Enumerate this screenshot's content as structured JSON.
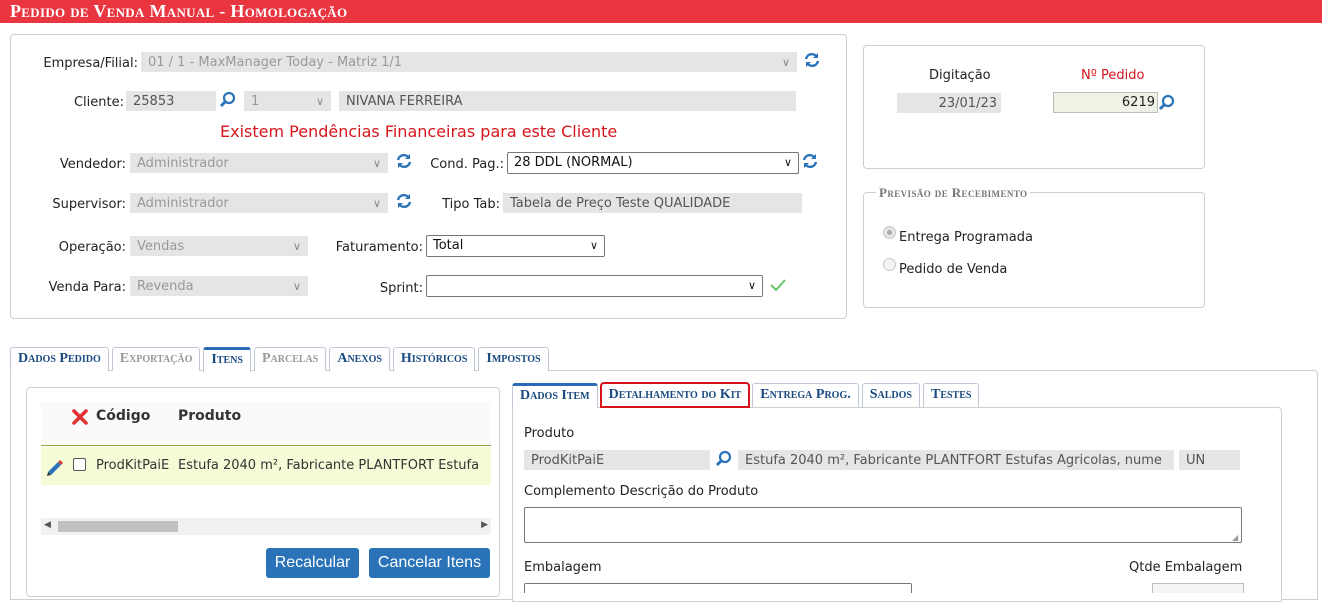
{
  "title": "Pedido de Venda Manual   - Homologação",
  "header": {
    "empresa_label": "Empresa/Filial:",
    "empresa_value": "01 / 1 - MaxManager Today - Matriz 1/1",
    "cliente_label": "Cliente:",
    "cliente_code": "25853",
    "cliente_seq": "1",
    "cliente_name": "NIVANA FERREIRA",
    "pendencias": "Existem Pendências Financeiras para este Cliente",
    "vendedor_label": "Vendedor:",
    "vendedor_value": "Administrador",
    "cond_pag_label": "Cond. Pag.:",
    "cond_pag_value": "28 DDL (NORMAL)",
    "supervisor_label": "Supervisor:",
    "supervisor_value": "Administrador",
    "tipo_tab_label": "Tipo Tab:",
    "tipo_tab_value": "Tabela de Preço Teste QUALIDADE",
    "operacao_label": "Operação:",
    "operacao_value": "Vendas",
    "faturamento_label": "Faturamento:",
    "faturamento_value": "Total",
    "venda_para_label": "Venda Para:",
    "venda_para_value": "Revenda",
    "sprint_label": "Sprint:",
    "sprint_value": ""
  },
  "order_box": {
    "digitacao_label": "Digitação",
    "digitacao_value": "23/01/23",
    "pedido_label": "Nº Pedido",
    "pedido_value": "6219"
  },
  "previsao": {
    "legend": "Previsão de Recebimento",
    "option1": "Entrega Programada",
    "option2": "Pedido de Venda"
  },
  "main_tabs": [
    "Dados Pedido",
    "Exportação",
    "Itens",
    "Parcelas",
    "Anexos",
    "Históricos",
    "Impostos"
  ],
  "items_grid": {
    "col_codigo": "Código",
    "col_produto": "Produto",
    "row_codigo": "ProdKitPaiE",
    "row_produto": "Estufa 2040 m², Fabricante PLANTFORT Estufa"
  },
  "buttons": {
    "recalcular": "Recalcular",
    "cancelar": "Cancelar Itens"
  },
  "item_tabs": [
    "Dados Item",
    "Detalhamento do Kit",
    "Entrega Prog.",
    "Saldos",
    "Testes"
  ],
  "item_detail": {
    "produto_label": "Produto",
    "produto_code": "ProdKitPaiE",
    "produto_desc": "Estufa 2040 m², Fabricante PLANTFORT Estufas Agricolas, nume",
    "produto_un": "UN",
    "complemento_label": "Complemento Descrição do Produto",
    "complemento_value": "",
    "embalagem_label": "Embalagem",
    "qtde_embalagem_label": "Qtde Embalagem"
  },
  "colors": {
    "title_bg": "#e8353f",
    "accent_blue": "#2a73b8",
    "warning_red": "#d7141c",
    "row_highlight": "#f5fbd6"
  }
}
